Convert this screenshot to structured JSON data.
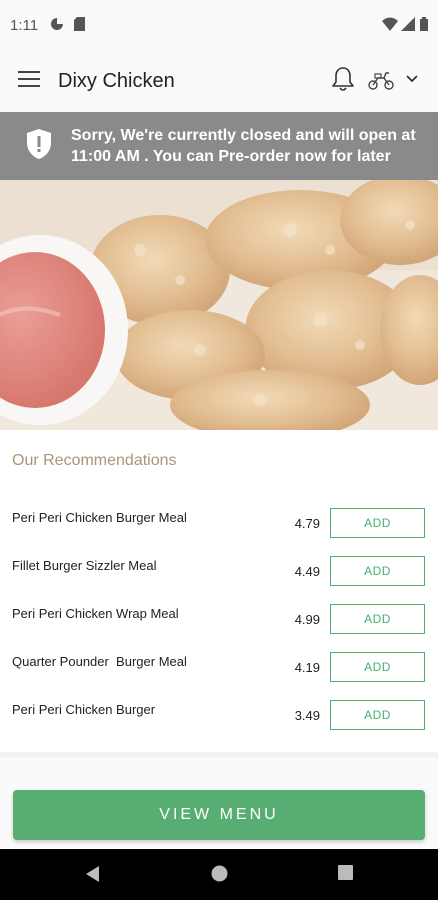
{
  "status_bar": {
    "time": "1:11"
  },
  "app_bar": {
    "title": "Dixy Chicken"
  },
  "banner": {
    "message": "Sorry, We're currently closed and will open at 11:00 AM . You can Pre-order now for later"
  },
  "recommendations": {
    "title": "Our Recommendations",
    "add_label": "ADD",
    "items": [
      {
        "name": "Peri Peri Chicken Burger Meal",
        "price": "4.79"
      },
      {
        "name": "Fillet Burger Sizzler Meal",
        "price": "4.49"
      },
      {
        "name": "Peri Peri Chicken Wrap Meal",
        "price": "4.99"
      },
      {
        "name": "Quarter Pounder  Burger Meal",
        "price": "4.19"
      },
      {
        "name": "Peri Peri Chicken Burger",
        "price": "3.49"
      }
    ]
  },
  "view_menu": {
    "label": "VIEW MENU"
  },
  "colors": {
    "accent_green": "#57ad72",
    "banner_gray": "#8a8a8a",
    "heading_gold": "#a89677"
  },
  "icons": [
    "menu-icon",
    "bell-icon",
    "scooter-icon",
    "chevron-down-icon",
    "shield-icon",
    "back-icon",
    "home-icon",
    "recents-icon"
  ]
}
